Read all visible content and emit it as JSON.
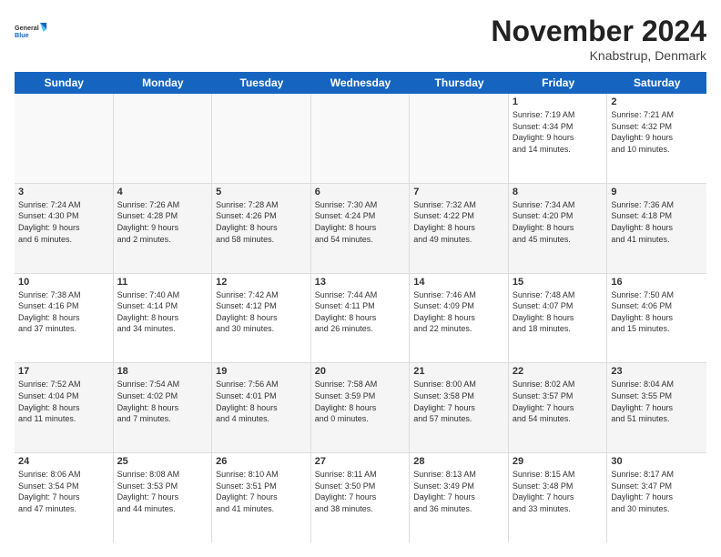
{
  "header": {
    "logo_line1": "General",
    "logo_line2": "Blue",
    "month": "November 2024",
    "location": "Knabstrup, Denmark"
  },
  "weekdays": [
    "Sunday",
    "Monday",
    "Tuesday",
    "Wednesday",
    "Thursday",
    "Friday",
    "Saturday"
  ],
  "weeks": [
    [
      {
        "day": "",
        "info": ""
      },
      {
        "day": "",
        "info": ""
      },
      {
        "day": "",
        "info": ""
      },
      {
        "day": "",
        "info": ""
      },
      {
        "day": "",
        "info": ""
      },
      {
        "day": "1",
        "info": "Sunrise: 7:19 AM\nSunset: 4:34 PM\nDaylight: 9 hours\nand 14 minutes."
      },
      {
        "day": "2",
        "info": "Sunrise: 7:21 AM\nSunset: 4:32 PM\nDaylight: 9 hours\nand 10 minutes."
      }
    ],
    [
      {
        "day": "3",
        "info": "Sunrise: 7:24 AM\nSunset: 4:30 PM\nDaylight: 9 hours\nand 6 minutes."
      },
      {
        "day": "4",
        "info": "Sunrise: 7:26 AM\nSunset: 4:28 PM\nDaylight: 9 hours\nand 2 minutes."
      },
      {
        "day": "5",
        "info": "Sunrise: 7:28 AM\nSunset: 4:26 PM\nDaylight: 8 hours\nand 58 minutes."
      },
      {
        "day": "6",
        "info": "Sunrise: 7:30 AM\nSunset: 4:24 PM\nDaylight: 8 hours\nand 54 minutes."
      },
      {
        "day": "7",
        "info": "Sunrise: 7:32 AM\nSunset: 4:22 PM\nDaylight: 8 hours\nand 49 minutes."
      },
      {
        "day": "8",
        "info": "Sunrise: 7:34 AM\nSunset: 4:20 PM\nDaylight: 8 hours\nand 45 minutes."
      },
      {
        "day": "9",
        "info": "Sunrise: 7:36 AM\nSunset: 4:18 PM\nDaylight: 8 hours\nand 41 minutes."
      }
    ],
    [
      {
        "day": "10",
        "info": "Sunrise: 7:38 AM\nSunset: 4:16 PM\nDaylight: 8 hours\nand 37 minutes."
      },
      {
        "day": "11",
        "info": "Sunrise: 7:40 AM\nSunset: 4:14 PM\nDaylight: 8 hours\nand 34 minutes."
      },
      {
        "day": "12",
        "info": "Sunrise: 7:42 AM\nSunset: 4:12 PM\nDaylight: 8 hours\nand 30 minutes."
      },
      {
        "day": "13",
        "info": "Sunrise: 7:44 AM\nSunset: 4:11 PM\nDaylight: 8 hours\nand 26 minutes."
      },
      {
        "day": "14",
        "info": "Sunrise: 7:46 AM\nSunset: 4:09 PM\nDaylight: 8 hours\nand 22 minutes."
      },
      {
        "day": "15",
        "info": "Sunrise: 7:48 AM\nSunset: 4:07 PM\nDaylight: 8 hours\nand 18 minutes."
      },
      {
        "day": "16",
        "info": "Sunrise: 7:50 AM\nSunset: 4:06 PM\nDaylight: 8 hours\nand 15 minutes."
      }
    ],
    [
      {
        "day": "17",
        "info": "Sunrise: 7:52 AM\nSunset: 4:04 PM\nDaylight: 8 hours\nand 11 minutes."
      },
      {
        "day": "18",
        "info": "Sunrise: 7:54 AM\nSunset: 4:02 PM\nDaylight: 8 hours\nand 7 minutes."
      },
      {
        "day": "19",
        "info": "Sunrise: 7:56 AM\nSunset: 4:01 PM\nDaylight: 8 hours\nand 4 minutes."
      },
      {
        "day": "20",
        "info": "Sunrise: 7:58 AM\nSunset: 3:59 PM\nDaylight: 8 hours\nand 0 minutes."
      },
      {
        "day": "21",
        "info": "Sunrise: 8:00 AM\nSunset: 3:58 PM\nDaylight: 7 hours\nand 57 minutes."
      },
      {
        "day": "22",
        "info": "Sunrise: 8:02 AM\nSunset: 3:57 PM\nDaylight: 7 hours\nand 54 minutes."
      },
      {
        "day": "23",
        "info": "Sunrise: 8:04 AM\nSunset: 3:55 PM\nDaylight: 7 hours\nand 51 minutes."
      }
    ],
    [
      {
        "day": "24",
        "info": "Sunrise: 8:06 AM\nSunset: 3:54 PM\nDaylight: 7 hours\nand 47 minutes."
      },
      {
        "day": "25",
        "info": "Sunrise: 8:08 AM\nSunset: 3:53 PM\nDaylight: 7 hours\nand 44 minutes."
      },
      {
        "day": "26",
        "info": "Sunrise: 8:10 AM\nSunset: 3:51 PM\nDaylight: 7 hours\nand 41 minutes."
      },
      {
        "day": "27",
        "info": "Sunrise: 8:11 AM\nSunset: 3:50 PM\nDaylight: 7 hours\nand 38 minutes."
      },
      {
        "day": "28",
        "info": "Sunrise: 8:13 AM\nSunset: 3:49 PM\nDaylight: 7 hours\nand 36 minutes."
      },
      {
        "day": "29",
        "info": "Sunrise: 8:15 AM\nSunset: 3:48 PM\nDaylight: 7 hours\nand 33 minutes."
      },
      {
        "day": "30",
        "info": "Sunrise: 8:17 AM\nSunset: 3:47 PM\nDaylight: 7 hours\nand 30 minutes."
      }
    ]
  ]
}
